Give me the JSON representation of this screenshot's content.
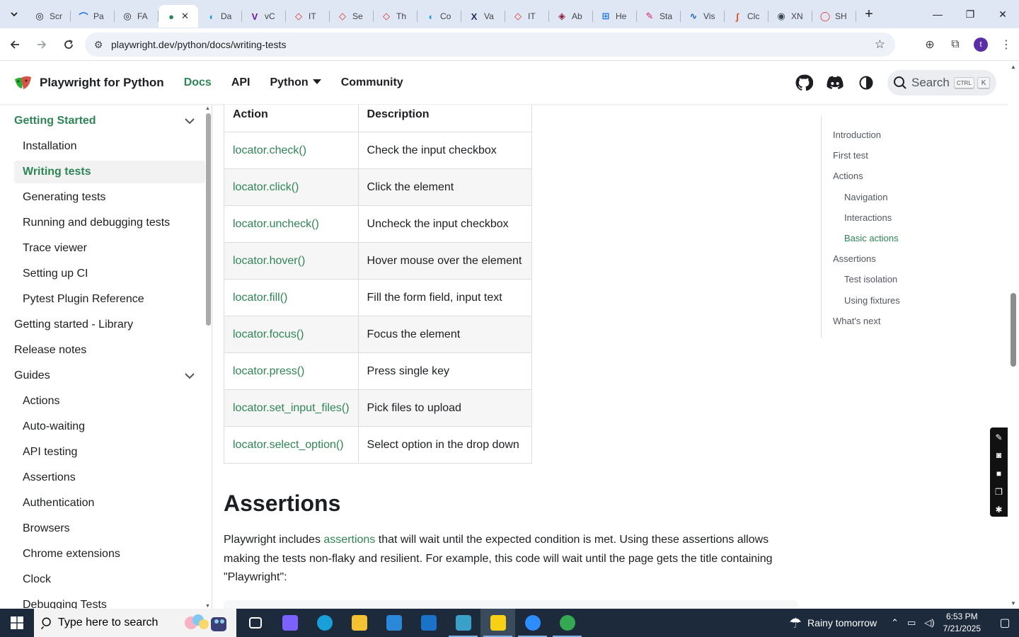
{
  "browser": {
    "tabs": [
      {
        "label": "Scr",
        "color": "#1f1f1f",
        "glyph": "◎"
      },
      {
        "label": "Pa",
        "color": "#1a73e8",
        "glyph": "⌒"
      },
      {
        "label": "FA",
        "color": "#1f1f1f",
        "glyph": "◎"
      },
      {
        "label": "",
        "color": "#2e8555",
        "glyph": "●",
        "active": true
      },
      {
        "label": "Da",
        "color": "#1b9bd7",
        "glyph": "◖"
      },
      {
        "label": "vC",
        "color": "#6a1b9a",
        "glyph": "V"
      },
      {
        "label": "IT",
        "color": "#d93025",
        "glyph": "◇"
      },
      {
        "label": "Se",
        "color": "#d93025",
        "glyph": "◇"
      },
      {
        "label": "Th",
        "color": "#d93025",
        "glyph": "◇"
      },
      {
        "label": "Co",
        "color": "#1b9bd7",
        "glyph": "◖"
      },
      {
        "label": "Va",
        "color": "#1f2a5a",
        "glyph": "X"
      },
      {
        "label": "IT",
        "color": "#d93025",
        "glyph": "◇"
      },
      {
        "label": "Ab",
        "color": "#8e1b3a",
        "glyph": "◈"
      },
      {
        "label": "He",
        "color": "#1a73e8",
        "glyph": "⊞"
      },
      {
        "label": "Sta",
        "color": "#d81b60",
        "glyph": "✎"
      },
      {
        "label": "Vis",
        "color": "#1565c0",
        "glyph": "∿"
      },
      {
        "label": "Clc",
        "color": "#e64a19",
        "glyph": "∫"
      },
      {
        "label": "XN",
        "color": "#37474f",
        "glyph": "◉"
      },
      {
        "label": "SH",
        "color": "#e53935",
        "glyph": "◯"
      }
    ],
    "url": "playwright.dev/python/docs/writing-tests",
    "profile_initial": "t"
  },
  "site": {
    "brand": "Playwright for Python",
    "nav": {
      "docs": "Docs",
      "api": "API",
      "python": "Python",
      "community": "Community"
    },
    "search_label": "Search",
    "kbd_ctrl": "CTRL",
    "kbd_k": "K"
  },
  "sidebar": {
    "items": [
      {
        "label": "Getting Started",
        "kind": "cat-green",
        "chevron": true
      },
      {
        "label": "Installation",
        "kind": "item"
      },
      {
        "label": "Writing tests",
        "kind": "active"
      },
      {
        "label": "Generating tests",
        "kind": "item"
      },
      {
        "label": "Running and debugging tests",
        "kind": "item"
      },
      {
        "label": "Trace viewer",
        "kind": "item"
      },
      {
        "label": "Setting up CI",
        "kind": "item"
      },
      {
        "label": "Pytest Plugin Reference",
        "kind": "item"
      },
      {
        "label": "Getting started - Library",
        "kind": "cat"
      },
      {
        "label": "Release notes",
        "kind": "cat"
      },
      {
        "label": "Guides",
        "kind": "cat",
        "chevron": true
      },
      {
        "label": "Actions",
        "kind": "item"
      },
      {
        "label": "Auto-waiting",
        "kind": "item"
      },
      {
        "label": "API testing",
        "kind": "item"
      },
      {
        "label": "Assertions",
        "kind": "item"
      },
      {
        "label": "Authentication",
        "kind": "item"
      },
      {
        "label": "Browsers",
        "kind": "item"
      },
      {
        "label": "Chrome extensions",
        "kind": "item"
      },
      {
        "label": "Clock",
        "kind": "item"
      },
      {
        "label": "Debugging Tests",
        "kind": "item"
      }
    ]
  },
  "table": {
    "headers": [
      "Action",
      "Description"
    ],
    "rows": [
      [
        "locator.check()",
        "Check the input checkbox"
      ],
      [
        "locator.click()",
        "Click the element"
      ],
      [
        "locator.uncheck()",
        "Uncheck the input checkbox"
      ],
      [
        "locator.hover()",
        "Hover mouse over the element"
      ],
      [
        "locator.fill()",
        "Fill the form field, input text"
      ],
      [
        "locator.focus()",
        "Focus the element"
      ],
      [
        "locator.press()",
        "Press single key"
      ],
      [
        "locator.set_input_files()",
        "Pick files to upload"
      ],
      [
        "locator.select_option()",
        "Select option in the drop down"
      ]
    ]
  },
  "content": {
    "heading": "Assertions",
    "para_before": "Playwright includes ",
    "para_link": "assertions",
    "para_after": " that will wait until the expected condition is met. Using these assertions allows making the tests non-flaky and resilient. For example, this code will wait until the page gets the title containing \"Playwright\":"
  },
  "toc": {
    "items": [
      {
        "label": "Introduction",
        "level": "top"
      },
      {
        "label": "First test",
        "level": "top"
      },
      {
        "label": "Actions",
        "level": "top"
      },
      {
        "label": "Navigation",
        "level": "sub"
      },
      {
        "label": "Interactions",
        "level": "sub"
      },
      {
        "label": "Basic actions",
        "level": "sub",
        "active": true
      },
      {
        "label": "Assertions",
        "level": "top"
      },
      {
        "label": "Test isolation",
        "level": "sub"
      },
      {
        "label": "Using fixtures",
        "level": "sub"
      },
      {
        "label": "What's next",
        "level": "top"
      }
    ]
  },
  "taskbar": {
    "search_placeholder": "Type here to search",
    "weather": "Rainy tomorrow",
    "time": "6:53 PM",
    "date": "7/21/2025",
    "apps": [
      {
        "name": "task-view",
        "color": "#ffffff"
      },
      {
        "name": "copilot",
        "color": "#7b61ff"
      },
      {
        "name": "edge",
        "color": "#1aa0d8"
      },
      {
        "name": "file-explorer",
        "color": "#f3c233"
      },
      {
        "name": "store",
        "color": "#2b88d8"
      },
      {
        "name": "mail",
        "color": "#1a73c8"
      },
      {
        "name": "devtool",
        "color": "#3aa0c8"
      },
      {
        "name": "sticky-notes",
        "color": "#f8d117"
      },
      {
        "name": "zoom",
        "color": "#2d8cff"
      },
      {
        "name": "chrome",
        "color": "#34a853"
      }
    ]
  }
}
